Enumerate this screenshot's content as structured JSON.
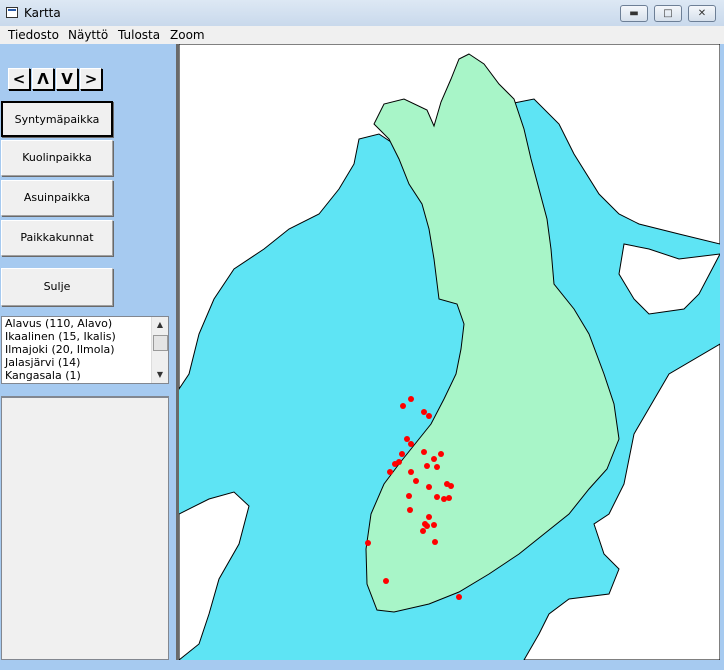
{
  "window": {
    "title": "Kartta",
    "icon": "app-window-icon",
    "buttons": {
      "minimize": "minimize-icon",
      "maximize": "maximize-icon",
      "close": "close-icon"
    }
  },
  "menu": [
    "Tiedosto",
    "Näyttö",
    "Tulosta",
    "Zoom"
  ],
  "nav": {
    "left": "<",
    "up": "Λ",
    "down": "V",
    "right": ">"
  },
  "buttons": {
    "birthplace": "Syntymäpaikka",
    "deathplace": "Kuolinpaikka",
    "residence": "Asuinpaikka",
    "localities": "Paikkakunnat",
    "close": "Sulje"
  },
  "places": [
    "Alavus (110, Alavo)",
    "Ikaalinen (15, Ikalis)",
    "Ilmajoki (20, Ilmola)",
    "Jalasjärvi (14)",
    "Kangasala (1)"
  ],
  "colors": {
    "sea": "#5ee4f4",
    "land_finland": "#a8f5c8",
    "land_other": "#ffffff",
    "marker": "#ff0000",
    "panel": "#a6caf0"
  }
}
